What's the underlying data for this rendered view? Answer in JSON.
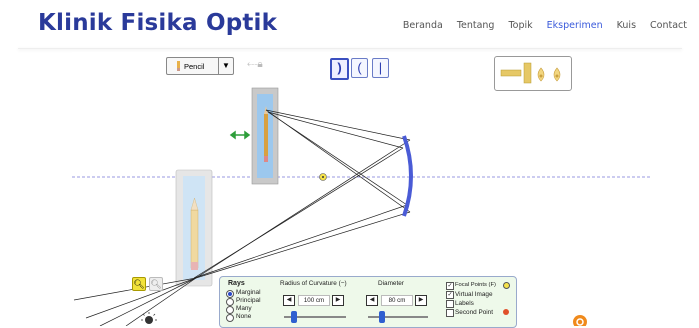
{
  "brand": "Klinik Fisika Optik",
  "nav": [
    "Beranda",
    "Tentang",
    "Topik",
    "Eksperimen",
    "Kuis",
    "Contact"
  ],
  "nav_active": "Eksperimen",
  "object_select": "Pencil",
  "mirror_buttons": [
    ")",
    "(",
    "|"
  ],
  "rays": {
    "title": "Rays",
    "options": [
      "Marginal",
      "Principal",
      "Many",
      "None"
    ],
    "selected": "Marginal"
  },
  "radius": {
    "label": "Radius of Curvature (−)",
    "value": "100 cm",
    "fraction": 0.25
  },
  "diameter": {
    "label": "Diameter",
    "value": "80 cm",
    "fraction": 0.38
  },
  "checks": [
    {
      "label": "Focal Points (F)",
      "checked": true
    },
    {
      "label": "Virtual Image",
      "checked": true
    },
    {
      "label": "Labels",
      "checked": false
    },
    {
      "label": "Second Point",
      "checked": false
    }
  ],
  "colors": {
    "brand": "#2a3a9a",
    "nav_active": "#3b5bdb",
    "mirror": "#4a5bd6",
    "panel": "#eef9ea",
    "axis": "#7a7ad8"
  },
  "icons": {
    "zoom_in": "zoom-in-icon",
    "zoom_out": "zoom-out-icon",
    "lock": "lock-icon",
    "move": "move-arrows-icon",
    "light": "light-source-icon"
  }
}
